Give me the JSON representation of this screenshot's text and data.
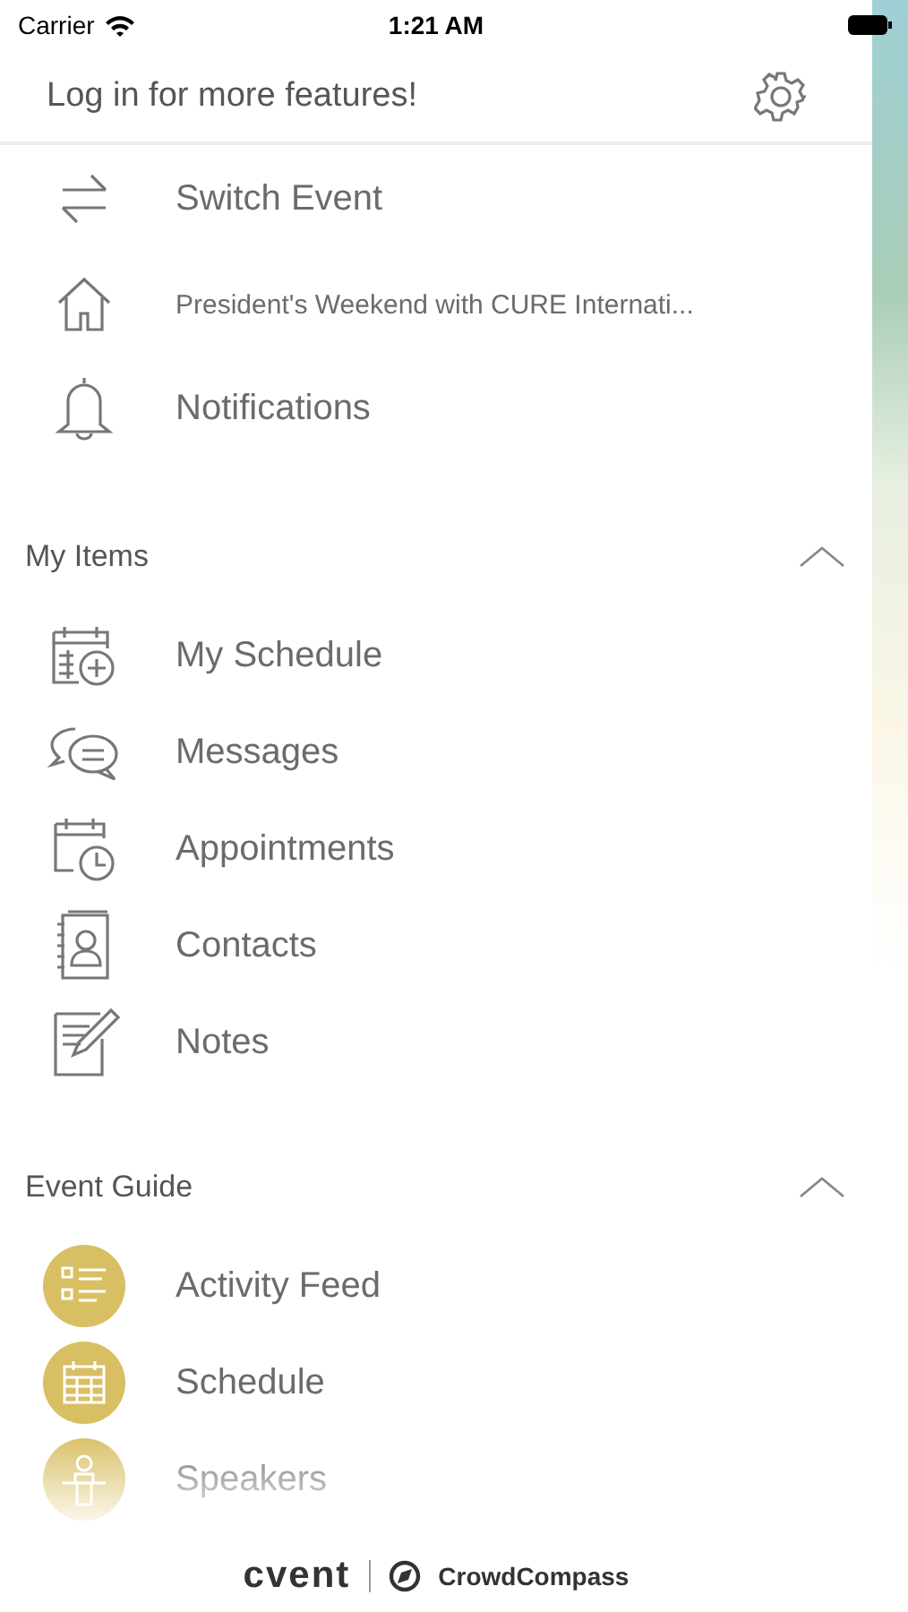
{
  "status_bar": {
    "carrier": "Carrier",
    "time": "1:21 AM"
  },
  "header": {
    "title": "Log in for more features!"
  },
  "top_items": [
    {
      "label": "Switch Event",
      "small": false
    },
    {
      "label": "President's Weekend with CURE Internati...",
      "small": true
    },
    {
      "label": "Notifications",
      "small": false
    }
  ],
  "sections": [
    {
      "title": "My Items",
      "expanded": true,
      "items": [
        {
          "label": "My Schedule",
          "kind": "line"
        },
        {
          "label": "Messages",
          "kind": "line"
        },
        {
          "label": "Appointments",
          "kind": "line"
        },
        {
          "label": "Contacts",
          "kind": "line"
        },
        {
          "label": "Notes",
          "kind": "line"
        }
      ]
    },
    {
      "title": "Event Guide",
      "expanded": true,
      "items": [
        {
          "label": "Activity Feed",
          "kind": "badge"
        },
        {
          "label": "Schedule",
          "kind": "badge"
        },
        {
          "label": "Speakers",
          "kind": "badge"
        }
      ]
    }
  ],
  "footer": {
    "brand": "cvent",
    "partner": "CrowdCompass"
  }
}
